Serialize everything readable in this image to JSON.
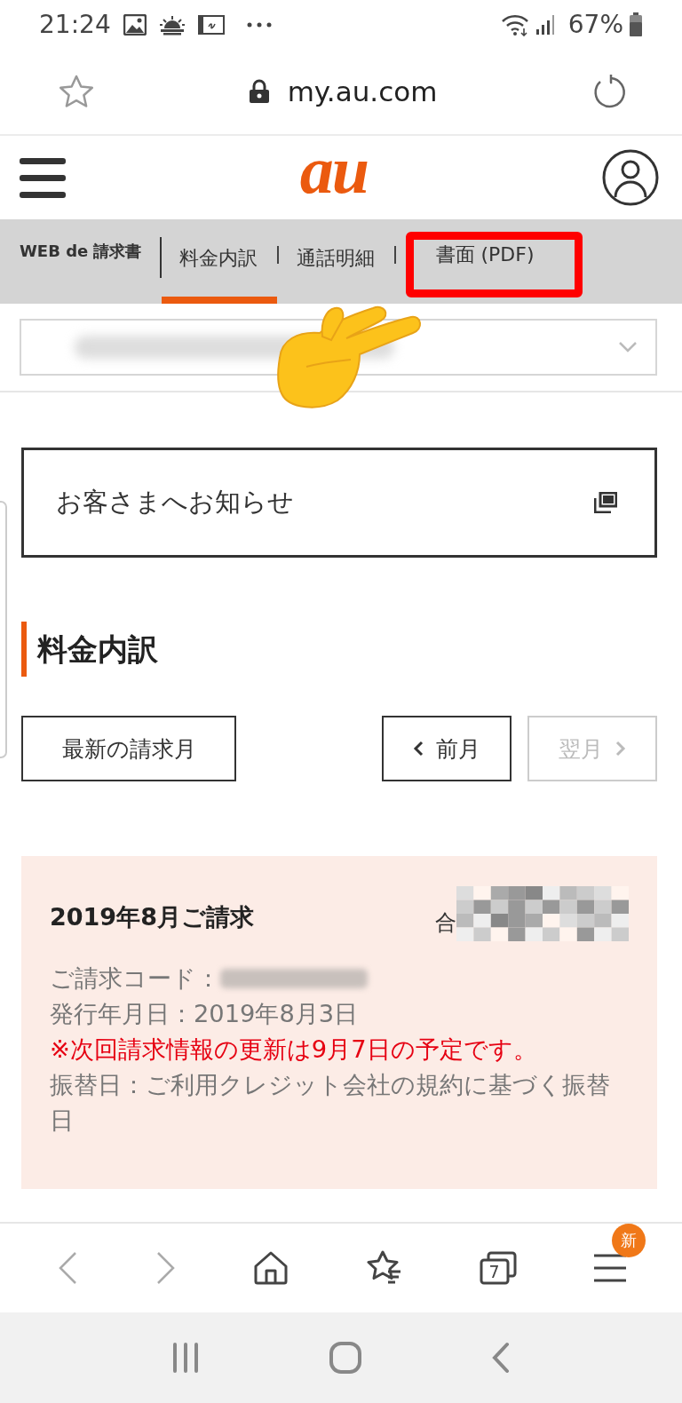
{
  "status_bar": {
    "time": "21:24",
    "battery": "67%"
  },
  "browser": {
    "url": "my.au.com"
  },
  "header": {
    "logo": "au"
  },
  "nav": {
    "title": "WEB de 請求書",
    "tabs": [
      {
        "label": "料金内訳",
        "selected": true,
        "highlighted": false
      },
      {
        "label": "通話明細",
        "selected": false,
        "highlighted": false
      },
      {
        "label": "書面 (PDF)",
        "selected": false,
        "highlighted": true
      }
    ]
  },
  "notice": {
    "label": "お客さまへお知らせ"
  },
  "section_title": "料金内訳",
  "month_buttons": [
    {
      "label": "最新の請求月",
      "kind": "latest",
      "disabled": false
    },
    {
      "label": "前月",
      "kind": "prev",
      "disabled": false
    },
    {
      "label": "翌月",
      "kind": "next",
      "disabled": true
    }
  ],
  "bill": {
    "title": "2019年8月ご請求",
    "total_label": "合",
    "lines": [
      {
        "text": "ご請求コード：",
        "kind": "redacted"
      },
      {
        "text": "発行年月日：2019年8月3日",
        "kind": "info"
      },
      {
        "text": "※次回請求情報の更新は9月7日の予定です。",
        "kind": "alert"
      },
      {
        "text": "振替日：ご利用クレジット会社の規約に基づく振替日",
        "kind": "info"
      }
    ]
  },
  "browser_toolbar": {
    "tab_count": "7",
    "badge": "新"
  }
}
